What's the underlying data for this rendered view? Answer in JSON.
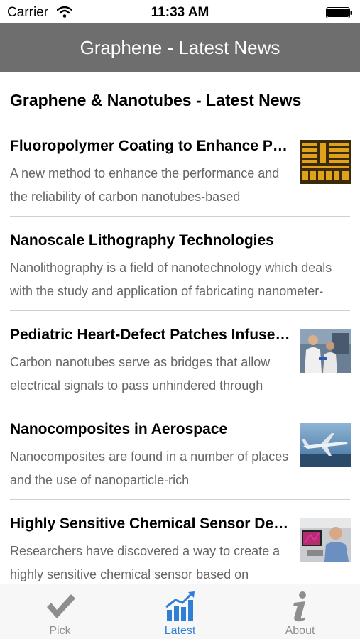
{
  "status_bar": {
    "carrier": "Carrier",
    "time": "11:33 AM"
  },
  "nav": {
    "title": "Graphene - Latest News"
  },
  "section": {
    "title": "Graphene & Nanotubes - Latest News"
  },
  "news": [
    {
      "title": "Fluoropolymer Coating to Enhance Performance",
      "description": "A new method to enhance the performance and the reliability of carbon nanotubes-based",
      "thumbnail": "chip-pattern-thumbnail"
    },
    {
      "title": "Nanoscale Lithography Technologies",
      "description": "Nanolithography is a field of nanotechnology which deals with the study and application of fabricating nanometer-",
      "thumbnail": ""
    },
    {
      "title": "Pediatric Heart-Defect Patches Infused with Nanotubes",
      "description": "Carbon nanotubes serve as bridges that allow electrical signals to pass unhindered through",
      "thumbnail": "lab-researchers-thumbnail"
    },
    {
      "title": "Nanocomposites in Aerospace",
      "description": "Nanocomposites are found in a number of places and the use of nanoparticle-rich",
      "thumbnail": "airplane-thumbnail"
    },
    {
      "title": "Highly Sensitive Chemical Sensor Developed",
      "description": "Researchers have discovered a way to create a highly sensitive chemical sensor based on",
      "thumbnail": "scientist-thumbnail"
    }
  ],
  "tabs": [
    {
      "label": "Pick",
      "icon": "checkmark-icon",
      "active": false
    },
    {
      "label": "Latest",
      "icon": "chart-icon",
      "active": true
    },
    {
      "label": "About",
      "icon": "info-icon",
      "active": false
    }
  ],
  "colors": {
    "nav_background": "#6e6e6e",
    "tab_active": "#2f7fd6",
    "tab_inactive": "#8e8e8e"
  }
}
